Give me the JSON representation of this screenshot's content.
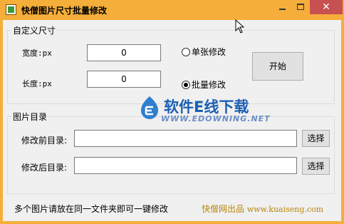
{
  "window": {
    "title": "快僧图片尺寸批量修改",
    "close_glyph": "✕"
  },
  "size_group": {
    "title": "自定义尺寸",
    "width_label": "宽度:px",
    "width_value": "0",
    "height_label": "长度:px",
    "height_value": "0",
    "radio_single": "单张修改",
    "radio_batch": "批量修改",
    "selected_mode": "批量修改",
    "start_button": "开始"
  },
  "dir_group": {
    "title": "图片目录",
    "before_label": "修改前目录:",
    "before_value": "",
    "before_browse": "选择",
    "after_label": "修改后目录:",
    "after_value": "",
    "after_browse": "选择"
  },
  "footer": {
    "hint": "多个图片请放在同一文件夹即可一键修改",
    "credit": "快僧网出品",
    "url": "www.kuaiseng.com"
  },
  "watermark": {
    "logo": "软件E线下载",
    "url": "WWW.EDOWNING.NET"
  },
  "colors": {
    "titlebar": "#f5ae3a",
    "close_button": "#c75050",
    "credit_text": "#b8860b",
    "watermark": "#1a5fb4"
  }
}
